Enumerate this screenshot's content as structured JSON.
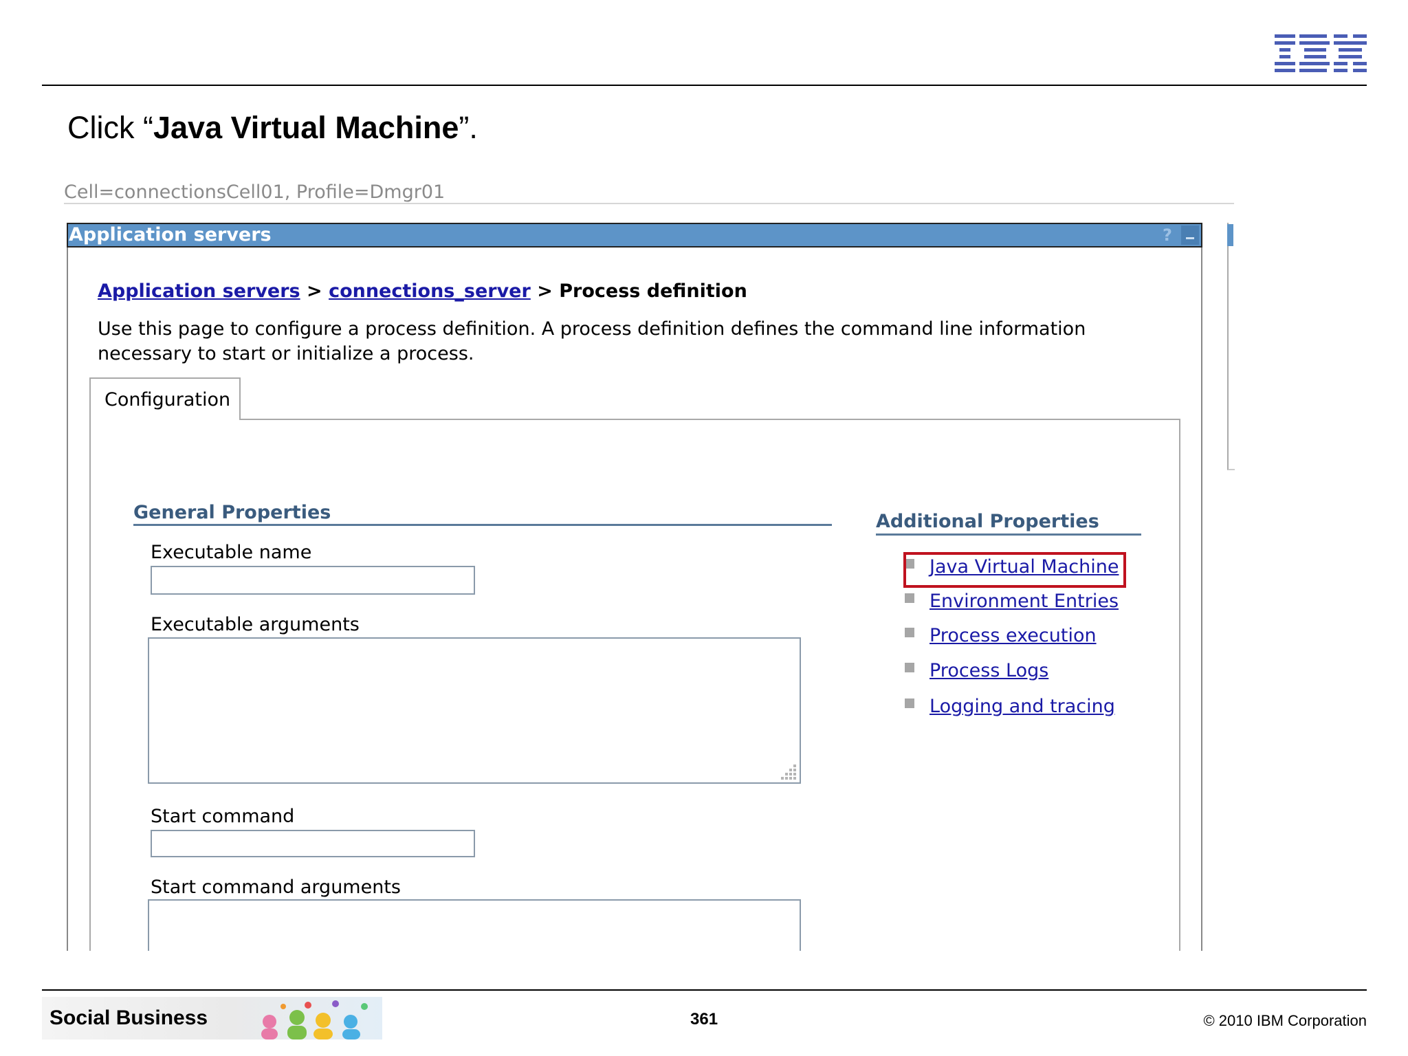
{
  "slide": {
    "instruction_prefix": "Click “",
    "instruction_bold": "Java Virtual Machine",
    "instruction_suffix": "”.",
    "logo_text": "IBM",
    "footer_title": "Social Business",
    "page_number": "361",
    "copyright": "© 2010 IBM Corporation"
  },
  "console": {
    "cell_info": "Cell=connectionsCell01, Profile=Dmgr01",
    "portlet_title": "Application servers",
    "help_icon": "?",
    "breadcrumb": {
      "link1": "Application servers",
      "sep1": " > ",
      "link2": "connections_server",
      "sep2": " > ",
      "current": "Process definition"
    },
    "description": "Use this page to configure a process definition. A process definition defines the command line information necessary to start or initialize a process.",
    "tab_label": "Configuration",
    "general_properties": {
      "title": "General Properties",
      "executable_name_label": "Executable name",
      "executable_name_value": "",
      "executable_arguments_label": "Executable arguments",
      "executable_arguments_value": "",
      "start_command_label": "Start command",
      "start_command_value": "",
      "start_command_arguments_label": "Start command arguments",
      "start_command_arguments_value": ""
    },
    "additional_properties": {
      "title": "Additional Properties",
      "items": [
        {
          "label": "Java Virtual Machine",
          "highlighted": true
        },
        {
          "label": "Environment Entries"
        },
        {
          "label": "Process execution"
        },
        {
          "label": "Process Logs"
        },
        {
          "label": "Logging and tracing"
        }
      ]
    },
    "colors": {
      "titlebar": "#5d94c8",
      "link": "#1a1aa6",
      "section_title": "#3a5b7e",
      "highlight_box": "#c0121f"
    }
  }
}
